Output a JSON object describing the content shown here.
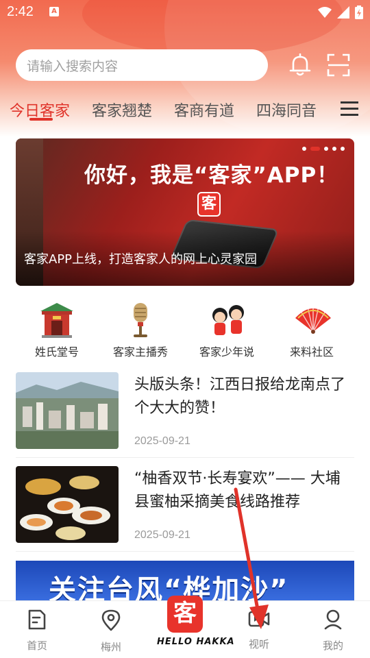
{
  "status_bar": {
    "time": "2:42",
    "notification_letter": "A"
  },
  "search": {
    "placeholder": "请输入搜索内容"
  },
  "tabs": [
    {
      "label": "今日客家",
      "active": true
    },
    {
      "label": "客家翘楚",
      "active": false
    },
    {
      "label": "客商有道",
      "active": false
    },
    {
      "label": "四海同音",
      "active": false
    }
  ],
  "banner": {
    "headline": "你好，我是“客家”APP！",
    "caption": "客家APP上线，打造客家人的网上心灵家园",
    "logo_char": "客",
    "slide_count": 5,
    "active_slide": 2
  },
  "quick_links": [
    {
      "label": "姓氏堂号",
      "icon": "ancestral-hall-icon"
    },
    {
      "label": "客家主播秀",
      "icon": "microphone-icon"
    },
    {
      "label": "客家少年说",
      "icon": "kids-icon"
    },
    {
      "label": "来料社区",
      "icon": "folding-fan-icon"
    }
  ],
  "news": [
    {
      "title": "头版头条！江西日报给龙南点了个大大的赞！",
      "date": "2025-09-21",
      "thumb": "city-aerial"
    },
    {
      "title": "“柚香双节·长寿宴欢”—— 大埔县蜜柚采摘美食线路推荐",
      "date": "2025-09-21",
      "thumb": "banquet-dishes"
    }
  ],
  "promo": {
    "text": "关注台风“桦加沙”"
  },
  "bottom_nav": {
    "items": [
      {
        "label": "首页",
        "icon": "home-doc-icon"
      },
      {
        "label": "梅州",
        "icon": "location-pin-icon"
      },
      {
        "label": "视听",
        "icon": "video-camera-icon"
      },
      {
        "label": "我的",
        "icon": "profile-icon"
      }
    ],
    "center": {
      "logo_char": "客",
      "text": "HELLO HAKKA"
    }
  },
  "colors": {
    "accent": "#e0332a",
    "header_gradient": "#f26a4f",
    "promo_blue": "#1d48b8"
  }
}
